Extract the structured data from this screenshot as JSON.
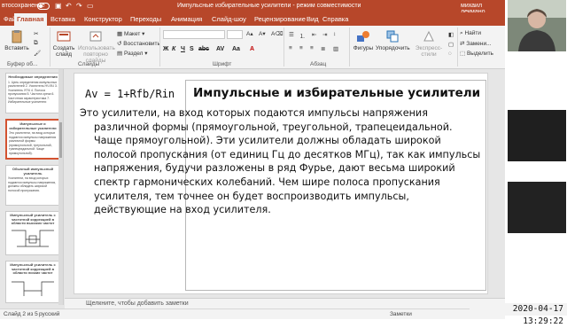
{
  "titlebar": {
    "autosave": "втосохранение",
    "doc_title": "Импульсные избирательные усилители - режим совместимости",
    "user": "михаил лекмано"
  },
  "tabs": [
    "Файл",
    "Главная",
    "Вставка",
    "Конструктор",
    "Переходы",
    "Анимация",
    "Слайд-шоу",
    "Рецензирование",
    "Вид",
    "Справка"
  ],
  "active_tab": "Главная",
  "ribbon": {
    "paste": "Вставить",
    "clipboard_group": "Буфер об...",
    "new_slide": "Создать слайд",
    "reuse_slides": "Использовать повторно слайды",
    "layout": "Макет",
    "reset": "Восстановить",
    "section": "Раздел",
    "slides_group": "Слайды",
    "font_group": "Шрифт",
    "paragraph_group": "Абзац",
    "shapes": "Фигуры",
    "arrange": "Упорядочить",
    "quick_styles": "Экспресс-стили",
    "find": "Найти",
    "replace": "Замени...",
    "select": "Выделить"
  },
  "thumbnails": [
    {
      "num": "",
      "title": "Необходимые определения",
      "text": "1. Цель определения импульсных усилителей 2. Усилитель НЧ ВЧ 3. Усилитель УПЧ 4. Полоса пропускания 5. Частота среза 6. Частотная характеристика 7. Избирательные усилители"
    },
    {
      "num": "",
      "title": "Импульсные и избирательные усилители",
      "text": "Это усилители, на вход которых подаются импульсы напряжения различной формы (прямоугольной, треугольной, трапецеидальной. Чаще прямоугольной)."
    },
    {
      "num": "",
      "title": "Обычный импульсный усилитель",
      "text": "Усилители, на вход которых подаются импульсы напряжения, должны обладать широкой полосой пропускания."
    },
    {
      "num": "",
      "title": "Импульсный усилитель с частотной коррекцией в области высоких частот",
      "text": ""
    },
    {
      "num": "",
      "title": "Импульсный усилитель с частотной коррекцией в области низких частот",
      "text": ""
    }
  ],
  "slide": {
    "formula": "Av = 1+Rfb/Rin",
    "title": "Импульсные и избирательные усилители",
    "body": "Это усилители, на вход которых подаются импульсы напряжения различной формы (прямоугольной, треугольной, трапецеидальной. Чаще прямоугольной). Эти усилители должны обладать широкой полосой пропускания (от единиц Гц до десятков МГц), так как импульсы напряжения, будучи разложены в ряд Фурье, дают весьма широкий спектр гармонических колебаний. Чем шире полоса пропускания усилителя, тем точнее он будет воспроизводить импульсы, действующие на вход усилителя."
  },
  "notes_placeholder": "Щелкните, чтобы добавить заметки",
  "status": {
    "slide": "Слайд 2 из 5",
    "language": "русский",
    "notes": "Заметки"
  },
  "clock": "2020-04-17  13:29:22",
  "colors": {
    "accent": "#b7472a",
    "selected": "#d35230"
  }
}
